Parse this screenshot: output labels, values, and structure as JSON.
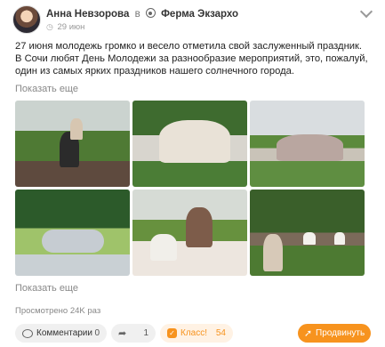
{
  "post": {
    "author": "Анна Невзорова",
    "in_word": "в",
    "place": "Ферма Экзархо",
    "date": "29 июн",
    "text_lines": [
      "27 июня молодежь громко и весело отметила свой заслуженный праздник.",
      "В Сочи любят День Молодежи за разнообразие мероприятий, это, пожалуй, один из самых ярких праздников нашего солнечного города."
    ],
    "show_more_text": "Показать еще",
    "show_more_photos": "Показать еще",
    "views": "Просмотрено 24K раз"
  },
  "actions": {
    "comments_label": "Комментарии",
    "comments_count": "0",
    "shares_count": "1",
    "klass_label": "Класс!",
    "klass_count": "54",
    "share_label": "Продвинуть"
  },
  "icons": {
    "place": "place-pin-icon",
    "date": "clock-icon",
    "menu": "chevron-down-icon",
    "comments": "comment-bubble-icon",
    "shares": "reshare-arrow-icon",
    "klass": "klass-icon",
    "promote": "promote-icon"
  },
  "colors": {
    "accent": "#f7931e",
    "muted": "#888888",
    "pill_bg": "#f0f0f0"
  }
}
